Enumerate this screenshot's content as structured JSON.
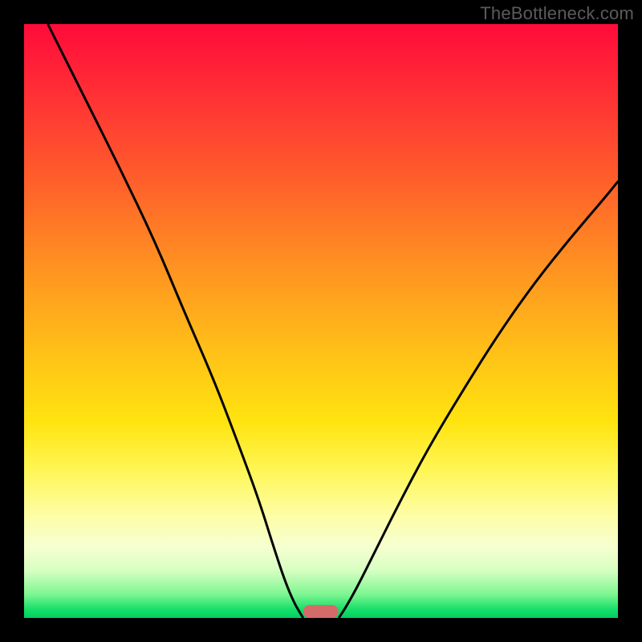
{
  "watermark": "TheBottleneck.com",
  "chart_data": {
    "type": "line",
    "title": "",
    "xlabel": "",
    "ylabel": "",
    "xlim": [
      0,
      100
    ],
    "ylim": [
      0,
      100
    ],
    "grid": false,
    "legend": false,
    "background": {
      "type": "vertical-gradient",
      "stops": [
        {
          "pos": 0,
          "color": "#ff0b3a"
        },
        {
          "pos": 0.1,
          "color": "#ff2a36"
        },
        {
          "pos": 0.25,
          "color": "#ff5a2c"
        },
        {
          "pos": 0.4,
          "color": "#ff8f22"
        },
        {
          "pos": 0.55,
          "color": "#ffc018"
        },
        {
          "pos": 0.67,
          "color": "#ffe410"
        },
        {
          "pos": 0.75,
          "color": "#fff654"
        },
        {
          "pos": 0.83,
          "color": "#fdfea8"
        },
        {
          "pos": 0.88,
          "color": "#f6ffd0"
        },
        {
          "pos": 0.92,
          "color": "#d7ffc2"
        },
        {
          "pos": 0.96,
          "color": "#7ef692"
        },
        {
          "pos": 0.985,
          "color": "#18e06a"
        },
        {
          "pos": 1.0,
          "color": "#00d060"
        }
      ]
    },
    "series": [
      {
        "name": "curve-left",
        "x": [
          4,
          10,
          16,
          22,
          27,
          32,
          36,
          39.5,
          42,
          44,
          45.5,
          46.5,
          47
        ],
        "y": [
          100,
          88,
          76,
          63.5,
          51.5,
          40,
          29.5,
          20,
          12,
          6,
          2.5,
          0.8,
          0
        ],
        "stroke": "#000000",
        "stroke_width": 3
      },
      {
        "name": "curve-right",
        "x": [
          53,
          54,
          56,
          59,
          63,
          68,
          74,
          80,
          86,
          92,
          98,
          100
        ],
        "y": [
          0,
          1.5,
          5,
          11,
          19,
          28.5,
          38.5,
          48,
          56.5,
          64,
          71,
          73.5
        ],
        "stroke": "#000000",
        "stroke_width": 3
      }
    ],
    "marker": {
      "shape": "rounded-rect",
      "center_x": 50,
      "bottom_y": 0,
      "width": 6,
      "height": 2.2,
      "color": "#d56a6a"
    },
    "frame_border_color": "#000000",
    "frame_border_px": 30
  }
}
